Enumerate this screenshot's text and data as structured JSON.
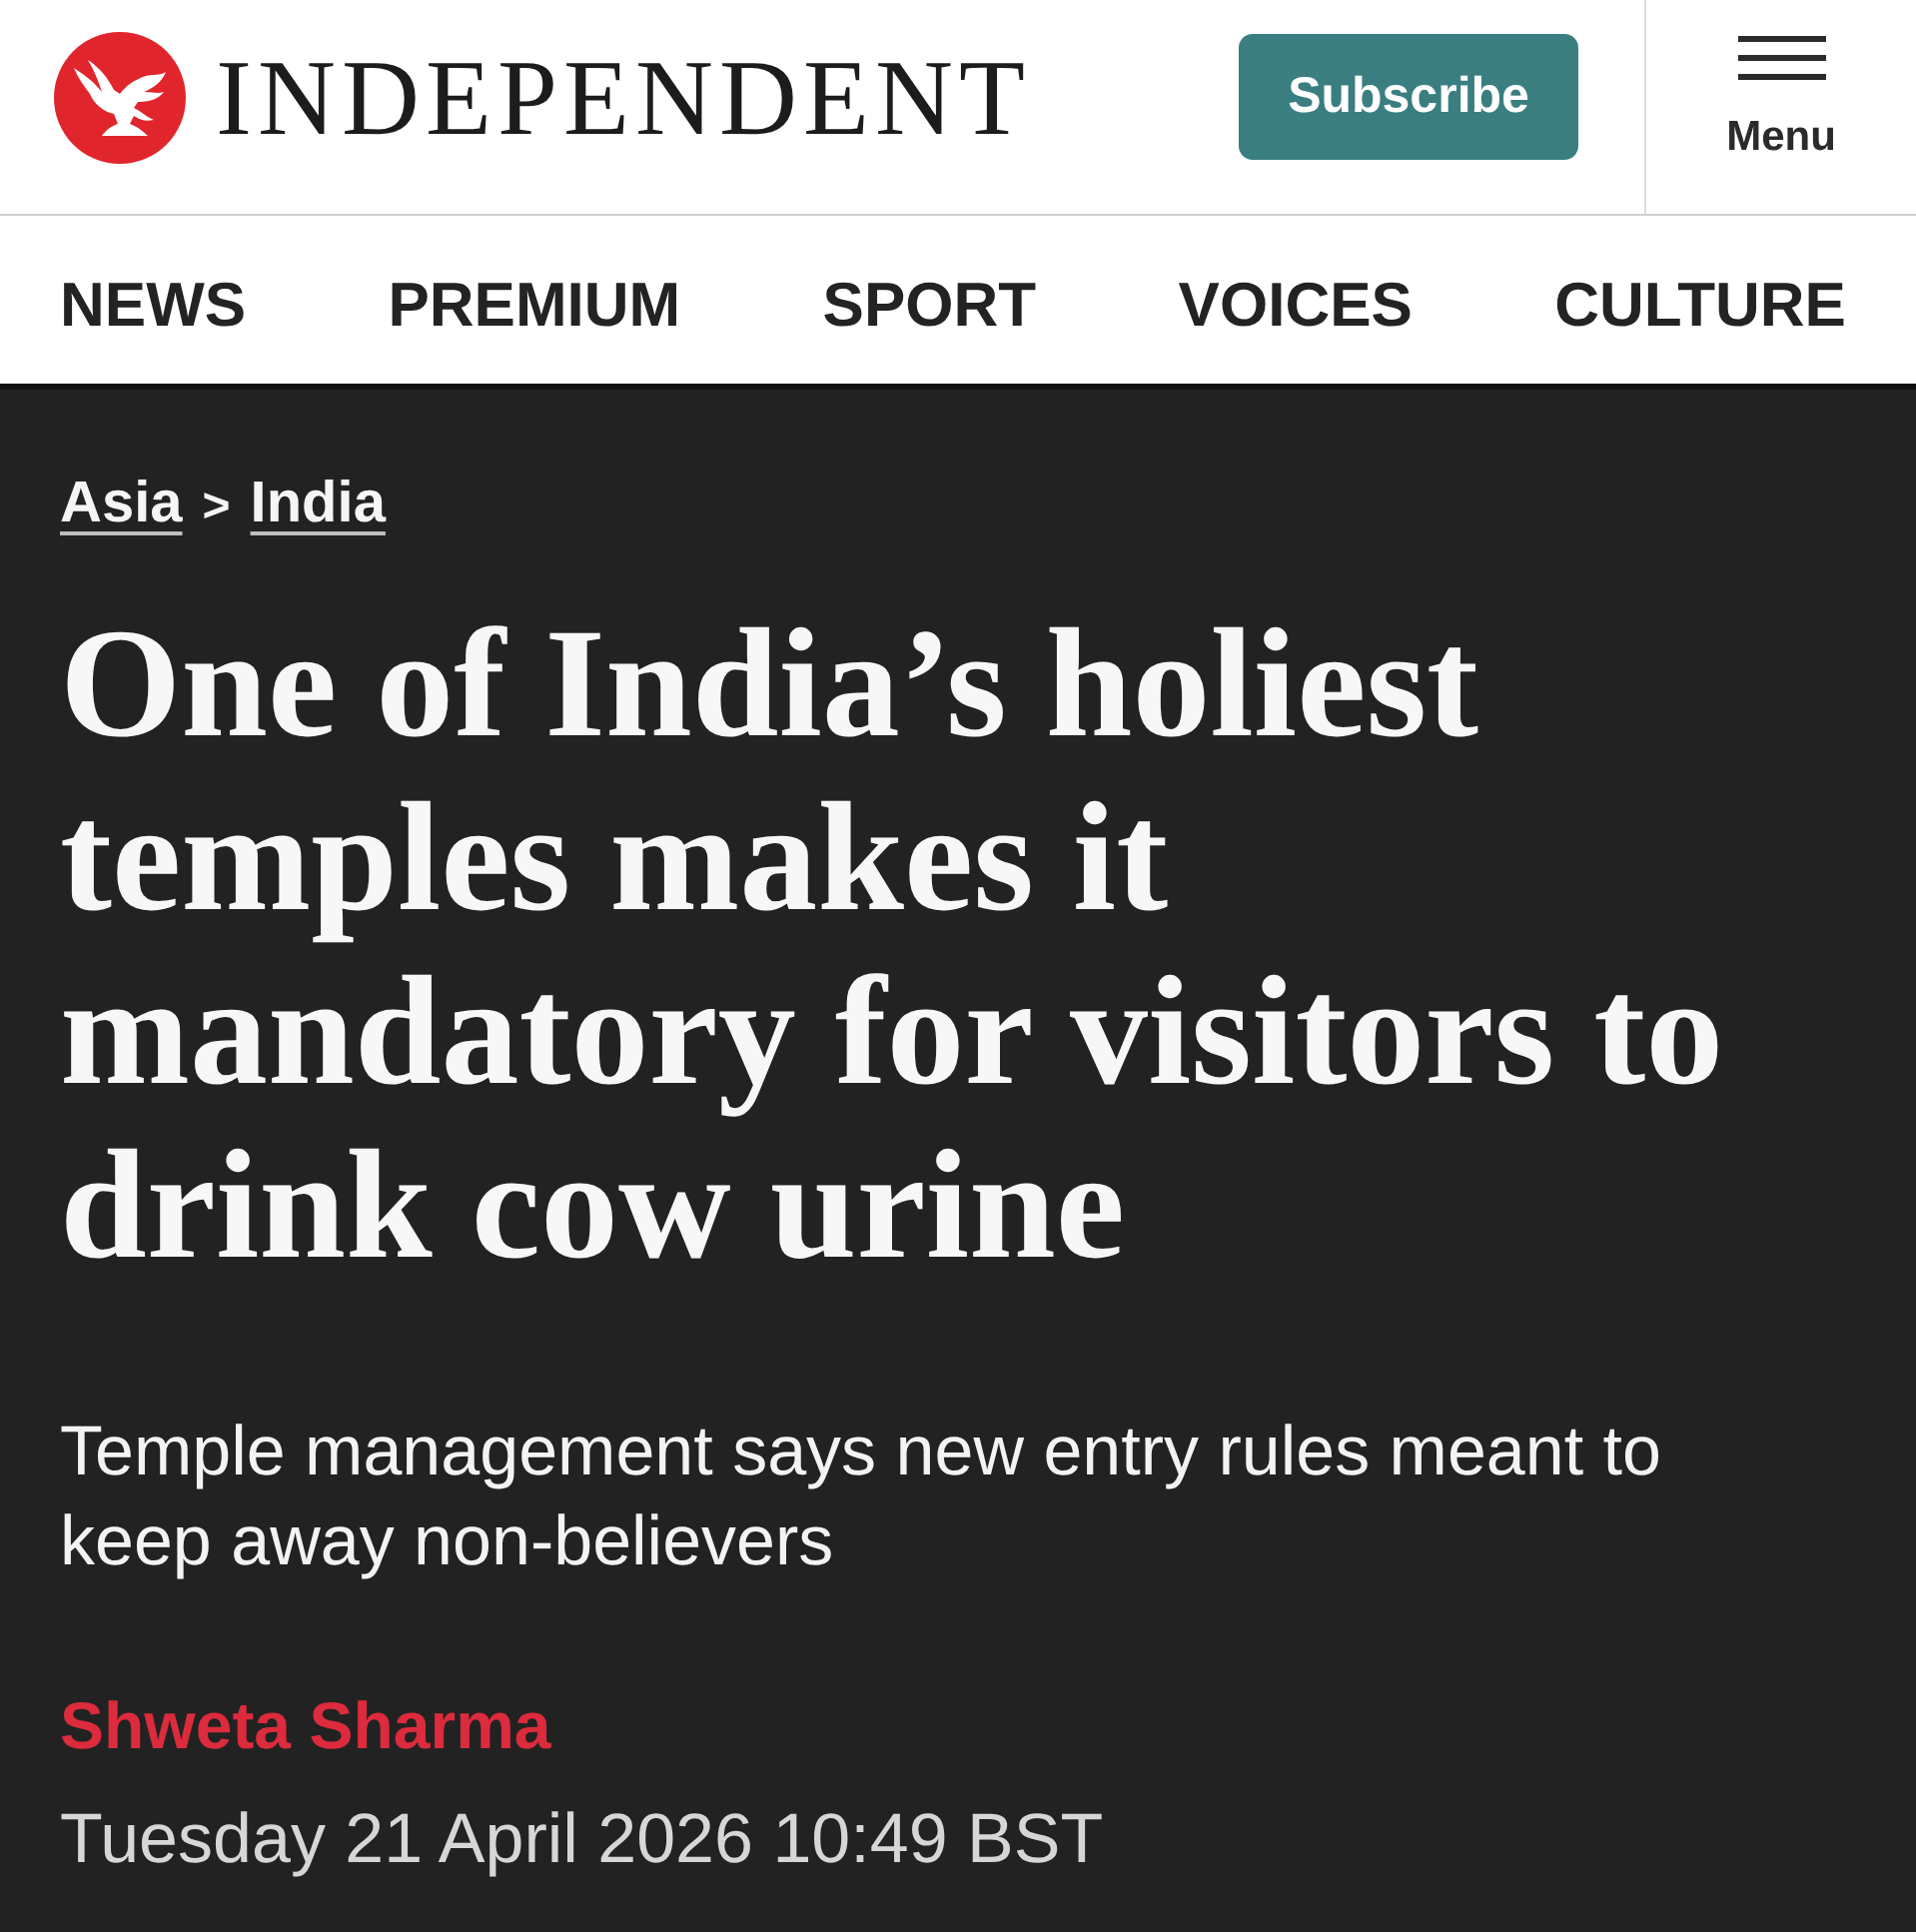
{
  "header": {
    "logo": {
      "wordmark": "INDEPENDENT"
    },
    "subscribe_button": {
      "label": "Subscribe"
    },
    "menu_button": {
      "label": "Menu"
    }
  },
  "nav": {
    "items": [
      {
        "label": "NEWS"
      },
      {
        "label": "PREMIUM"
      },
      {
        "label": "SPORT"
      },
      {
        "label": "VOICES"
      },
      {
        "label": "CULTURE"
      }
    ]
  },
  "article": {
    "breadcrumbs": {
      "items": [
        {
          "label": "Asia"
        },
        {
          "label": "India"
        }
      ],
      "separator": ">"
    },
    "headline": "One of India’s holiest temples makes it mandatory for visitors to drink cow urine",
    "standfirst": "Temple management says new entry rules meant to keep away non-believers",
    "author": "Shweta Sharma",
    "date": "Tuesday 21 April 2026 10:49 BST"
  }
}
